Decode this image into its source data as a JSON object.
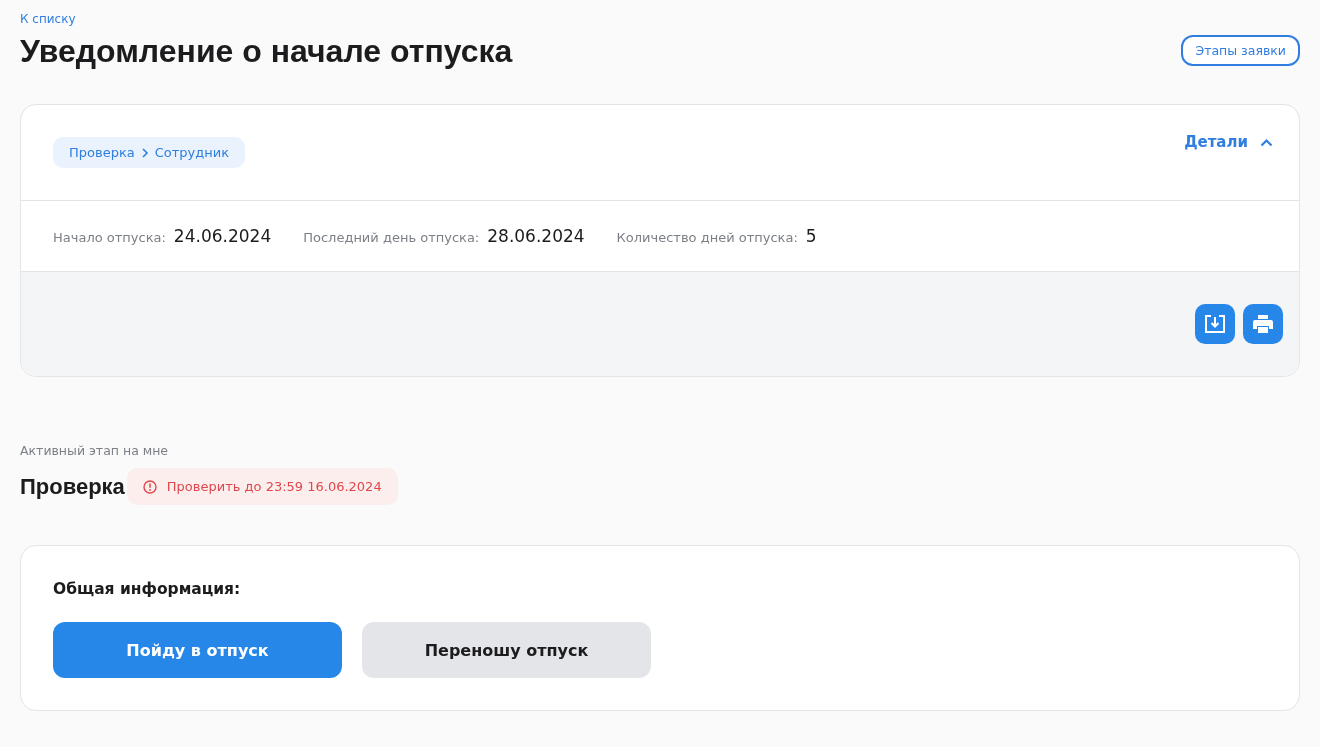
{
  "back_link": "К списку",
  "title": "Уведомление о начале отпуска",
  "stages_button": "Этапы заявки",
  "request_card": {
    "breadcrumb": [
      "Проверка",
      "Сотрудник"
    ],
    "details": {
      "label": "Детали",
      "expanded": true
    },
    "fields": [
      {
        "label": "Начало отпуска:",
        "value": "24.06.2024"
      },
      {
        "label": "Последний день отпуска:",
        "value": "28.06.2024"
      },
      {
        "label": "Количество дней отпуска:",
        "value": "5"
      }
    ],
    "actions": [
      {
        "kind": "download"
      },
      {
        "kind": "print"
      }
    ]
  },
  "active_stage": {
    "caption": "Активный этап на мне",
    "name": "Проверка",
    "deadline": "Проверить до 23:59 16.06.2024"
  },
  "info_card": {
    "heading": "Общая информация:",
    "buttons": [
      {
        "label": "Пойду в отпуск",
        "kind": "primary"
      },
      {
        "label": "Переношу отпуск",
        "kind": "secondary"
      }
    ]
  }
}
